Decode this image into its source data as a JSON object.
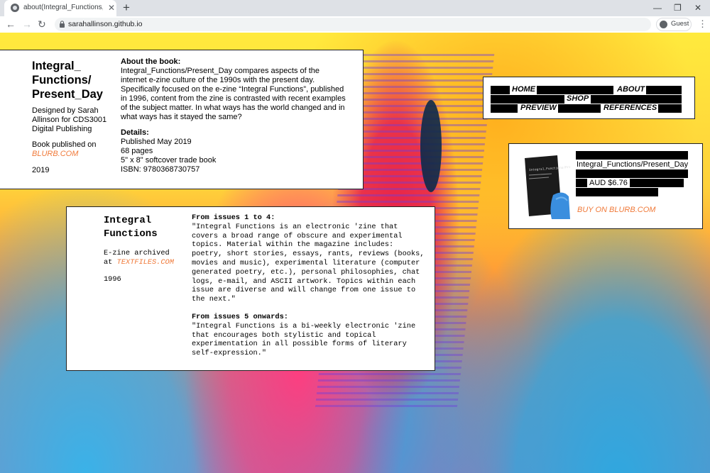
{
  "browser": {
    "tab_title": "about(Integral_Functions, Present_Day)",
    "tab_close": "✕",
    "new_tab": "+",
    "url": "sarahallinson.github.io",
    "profile_label": "Guest",
    "back": "←",
    "forward": "→",
    "reload": "↻",
    "minimize": "—",
    "restore": "❐",
    "close": "✕",
    "menu": "⋮"
  },
  "book": {
    "title_lines": [
      "Integral_",
      "Functions/",
      "Present_Day"
    ],
    "designed_by": "Designed by Sarah Allinson for CDS3001 Digital Publishing",
    "published_on": "Book published on",
    "blurb_link": "BLURB.COM",
    "year": "2019",
    "about_heading": "About the book:",
    "about_text": "Integral_Functions/Present_Day compares aspects of the internet e-zine culture of the 1990s with the present day. Specifically focused on the e-zine “Integral Functions”, published in 1996, content from the zine is contrasted with recent examples of the subject matter. In what ways has the world changed and in what ways has it stayed the same?",
    "details_heading": "Details:",
    "details": [
      "Published May 2019",
      "68 pages",
      "5\" x 8\" softcover trade book",
      "ISBN: 9780368730757"
    ]
  },
  "zine": {
    "title_lines": [
      "Integral",
      "Functions"
    ],
    "archived": "E-zine archived",
    "at": "at",
    "textfiles_link": "TEXTFILES.COM",
    "year": "1996",
    "issues_1_4_heading": "From issues 1 to 4:",
    "issues_1_4_text": "\"Integral Functions is an electronic 'zine that covers a broad range of obscure and experimental topics. Material within the magazine includes: poetry, short stories, essays, rants, reviews (books, movies and music), experimental literature (computer generated poetry, etc.), personal philosophies, chat logs, e-mail, and ASCII artwork. Topics within each issue are diverse and will change from one issue to the next.\"",
    "issues_5_heading": "From issues 5 onwards:",
    "issues_5_text": "\"Integral Functions is a bi-weekly electronic 'zine that encourages both stylistic and topical experimentation in all possible forms of literary self-expression.\""
  },
  "nav": {
    "home": "HOME",
    "about": "ABOUT",
    "shop": "SHOP",
    "preview": "PREVIEW",
    "references": "REFERENCES"
  },
  "shop": {
    "product_title": "Integral_Functions/Present_Day",
    "price": "AUD $6.76",
    "buy_link": "BUY ON BLURB.COM",
    "cover_text": "Integral_Functions/Present_Day"
  },
  "colors": {
    "link_orange": "#f07a3a",
    "bg_yellow": "#ffea3d",
    "bg_pink": "#ff4f7a",
    "bg_blue": "#2ea8e0"
  }
}
